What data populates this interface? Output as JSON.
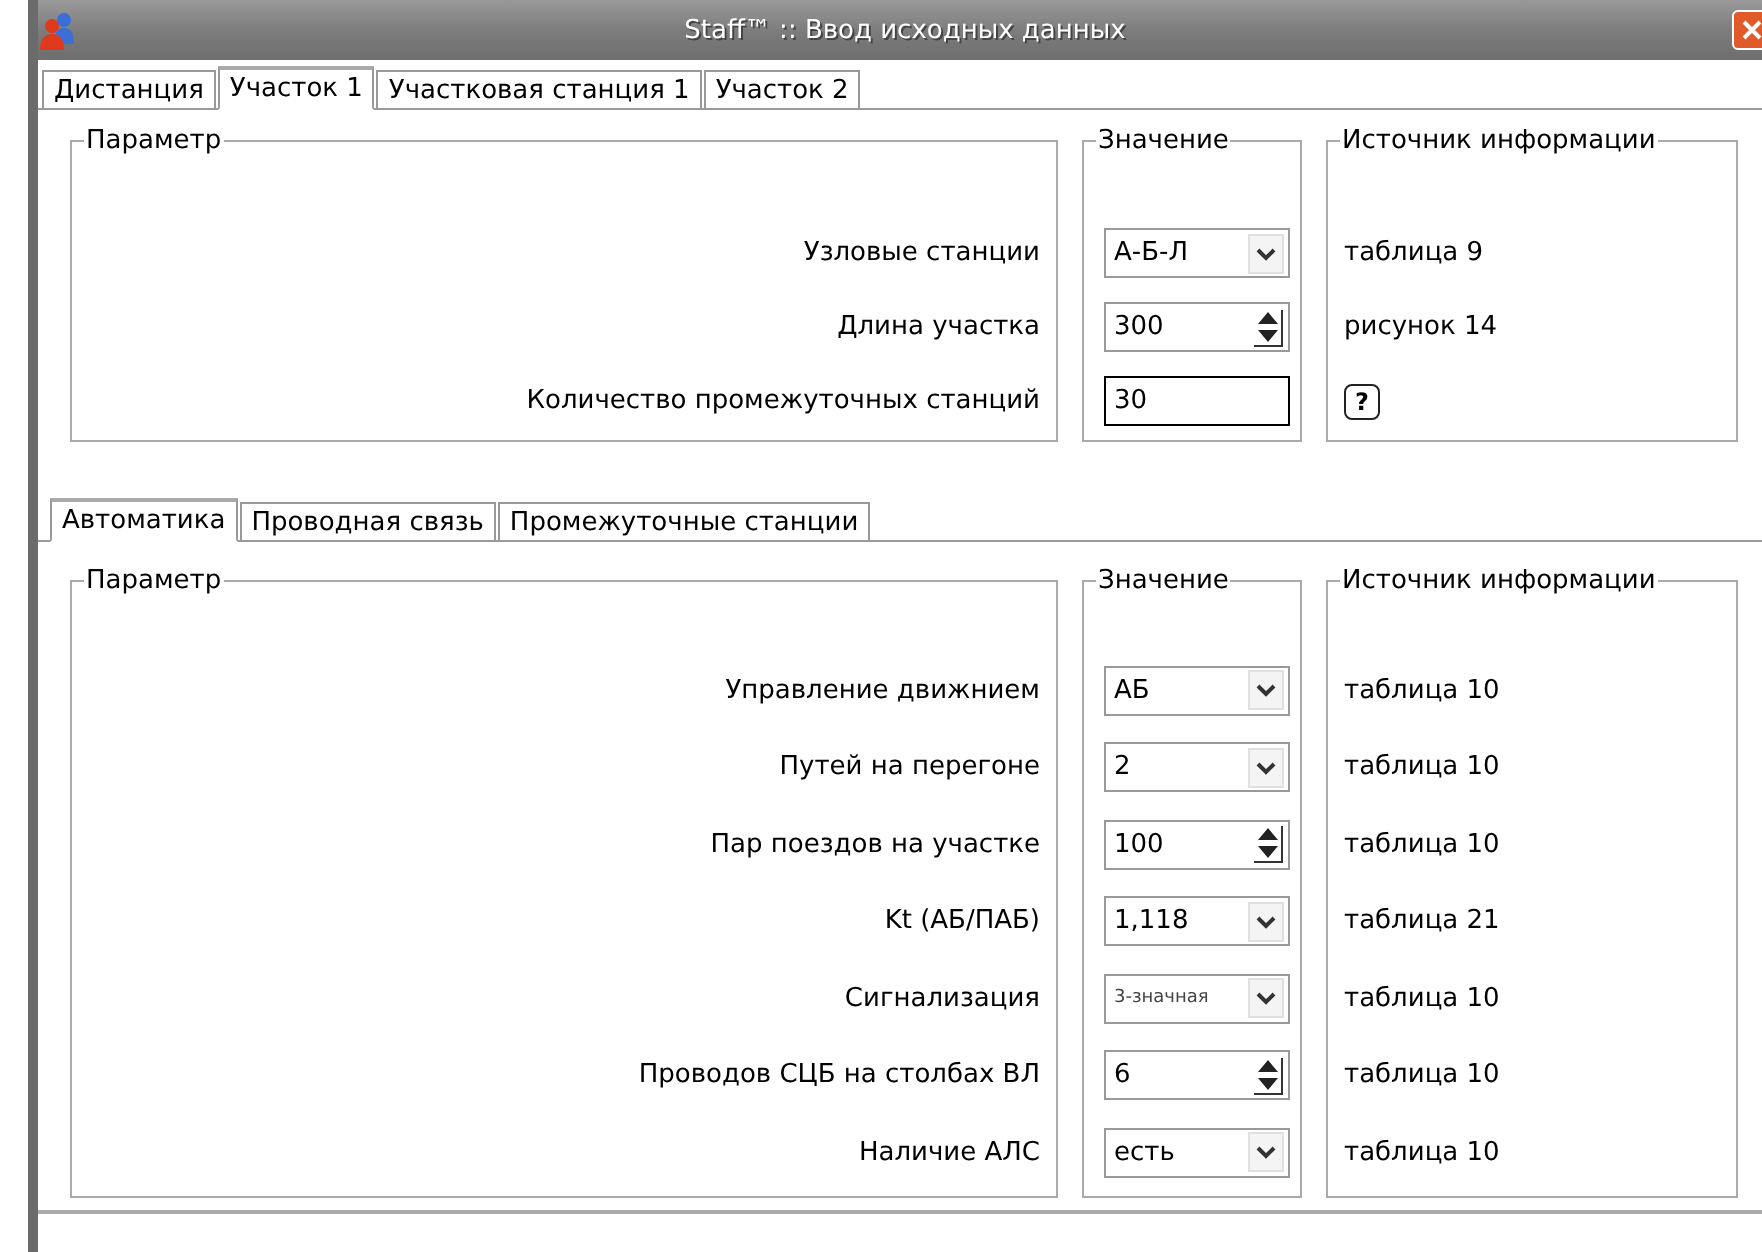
{
  "window": {
    "title": "Staff™ :: Ввод исходных данных"
  },
  "tabs": [
    {
      "label": "Дистанция",
      "selected": false
    },
    {
      "label": "Участок 1",
      "selected": true
    },
    {
      "label": "Участковая станция 1",
      "selected": false
    },
    {
      "label": "Участок 2",
      "selected": false
    }
  ],
  "section": {
    "headers": [
      "Параметр",
      "Значение",
      "Источник информации"
    ],
    "rows": [
      {
        "label": "Узловые станции",
        "field": {
          "kind": "combo",
          "value": "А-Б-Л"
        },
        "source": {
          "kind": "text",
          "text": "таблица 9"
        }
      },
      {
        "label": "Длина участка",
        "field": {
          "kind": "spin",
          "value": "300"
        },
        "source": {
          "kind": "text",
          "text": "рисунок 14"
        }
      },
      {
        "label": "Количество промежуточных станций",
        "field": {
          "kind": "text",
          "value": "30"
        },
        "source": {
          "kind": "help",
          "text": "?"
        }
      }
    ]
  },
  "subtabs": [
    {
      "label": "Автоматика",
      "selected": true
    },
    {
      "label": "Проводная связь",
      "selected": false
    },
    {
      "label": "Промежуточные станции",
      "selected": false
    }
  ],
  "subsection": {
    "headers": [
      "Параметр",
      "Значение",
      "Источник информации"
    ],
    "rows": [
      {
        "label": "Управление движнием",
        "field": {
          "kind": "combo",
          "value": "АБ"
        },
        "source": {
          "kind": "text",
          "text": "таблица 10"
        }
      },
      {
        "label": "Путей на перегоне",
        "field": {
          "kind": "combo",
          "value": "2"
        },
        "source": {
          "kind": "text",
          "text": "таблица 10"
        }
      },
      {
        "label": "Пар поездов на участке",
        "field": {
          "kind": "spin",
          "value": "100"
        },
        "source": {
          "kind": "text",
          "text": "таблица 10"
        }
      },
      {
        "label": "Kt (АБ/ПАБ)",
        "field": {
          "kind": "combo",
          "value": "1,118"
        },
        "source": {
          "kind": "text",
          "text": "таблица 21"
        }
      },
      {
        "label": "Сигнализация",
        "field": {
          "kind": "combo-small",
          "value": "3-значная"
        },
        "source": {
          "kind": "text",
          "text": "таблица 10"
        }
      },
      {
        "label": "Проводов СЦБ на столбах ВЛ",
        "field": {
          "kind": "spin",
          "value": "6"
        },
        "source": {
          "kind": "text",
          "text": "таблица 10"
        }
      },
      {
        "label": "Наличие АЛС",
        "field": {
          "kind": "combo",
          "value": "есть"
        },
        "source": {
          "kind": "text",
          "text": "таблица 10"
        }
      }
    ]
  }
}
